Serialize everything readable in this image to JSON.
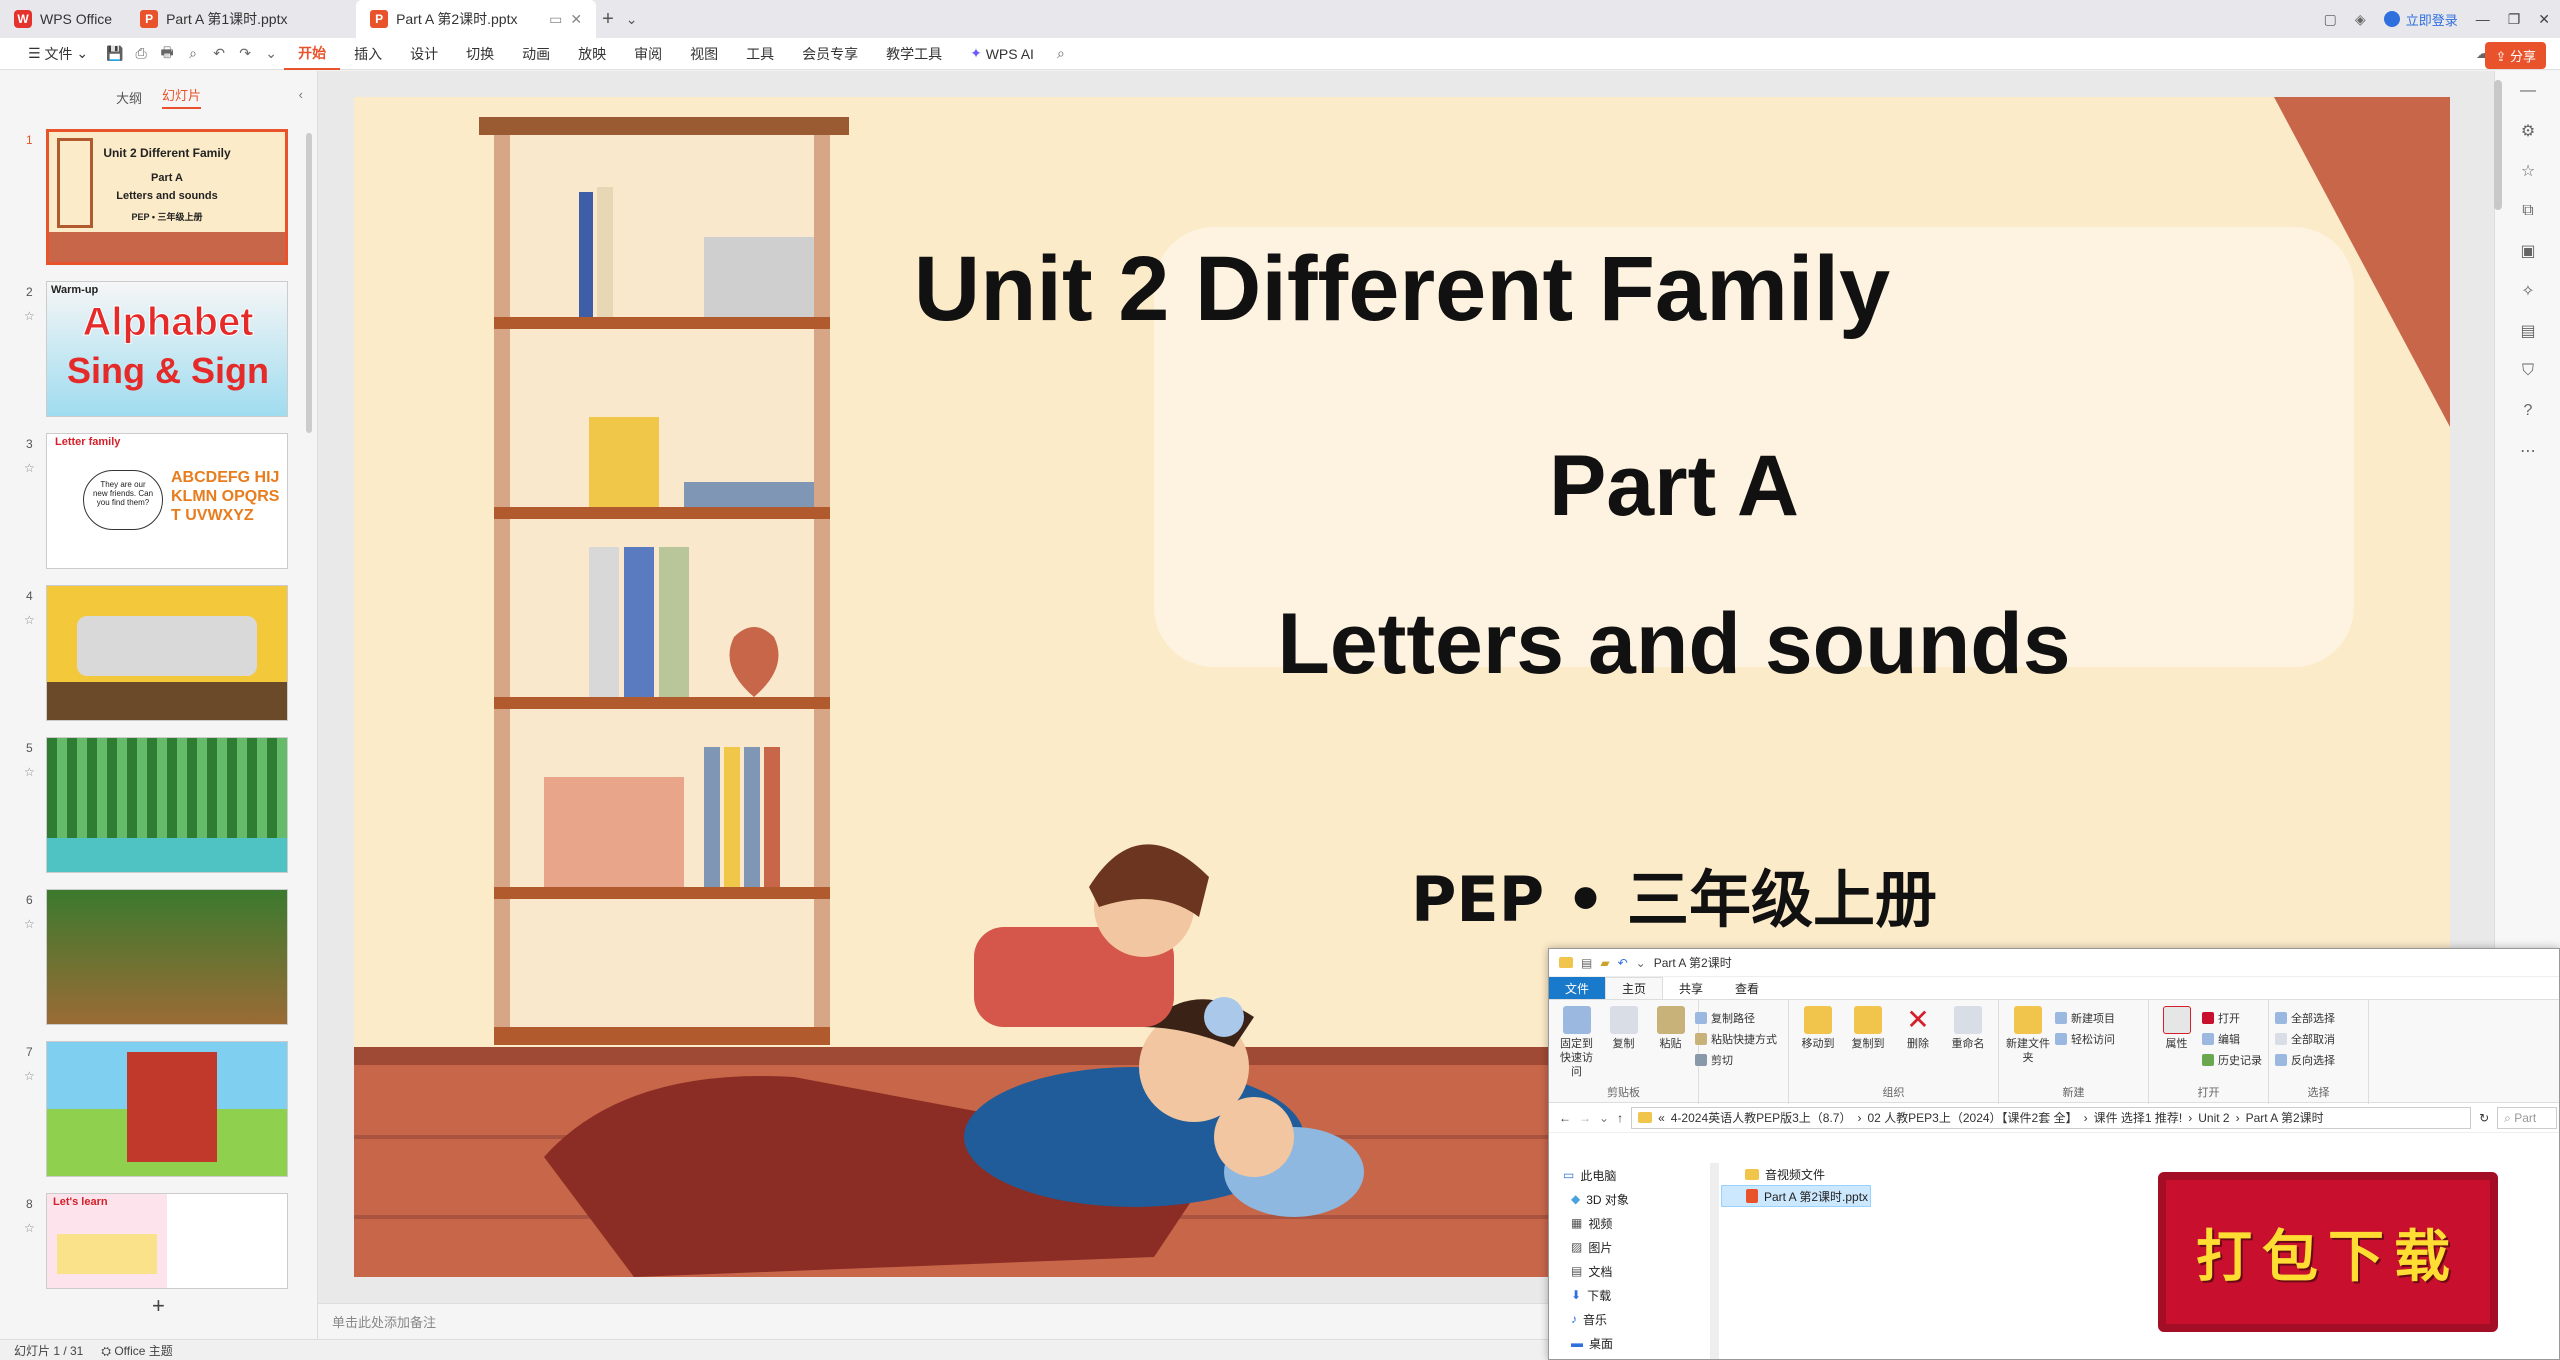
{
  "window": {
    "tabs": [
      {
        "label": "WPS Office"
      },
      {
        "label": "Part A 第1课时.pptx"
      },
      {
        "label": "Part A 第2课时.pptx"
      }
    ],
    "new_tab": "+",
    "login": "立即登录"
  },
  "menu": {
    "file": "文件",
    "items": [
      "开始",
      "插入",
      "设计",
      "切换",
      "动画",
      "放映",
      "审阅",
      "视图",
      "工具",
      "会员专享",
      "教学工具"
    ],
    "ai": "WPS AI",
    "share": "分享"
  },
  "panel": {
    "tab_outline": "大纲",
    "tab_slides": "幻灯片",
    "thumbs": [
      {
        "num": "1",
        "t1": "Unit 2 Different Family",
        "t2": "Part A",
        "t3": "Letters and sounds",
        "t4": "PEP • 三年级上册"
      },
      {
        "num": "2",
        "tag": "Warm-up",
        "t1": "Alphabet",
        "t2": "Sing & Sign"
      },
      {
        "num": "3",
        "tag": "Letter family",
        "bubble": "They are our new friends. Can you find them?",
        "letters": "ABCDEFG HIJKLMN OPQRST UVWXYZ"
      },
      {
        "num": "4"
      },
      {
        "num": "5"
      },
      {
        "num": "6"
      },
      {
        "num": "7"
      },
      {
        "num": "8",
        "tag": "Let's learn"
      }
    ]
  },
  "slide": {
    "title": "Unit 2 Different Family",
    "part": "Part A",
    "subtitle": "Letters and sounds",
    "edition": "PEP • 三年级上册"
  },
  "notes_placeholder": "单击此处添加备注",
  "status": {
    "slide_count": "幻灯片 1 / 31",
    "theme": "Office 主题"
  },
  "explorer": {
    "title": "Part A 第2课时",
    "tabs": [
      "文件",
      "主页",
      "共享",
      "查看"
    ],
    "groups": [
      {
        "name": "剪贴板",
        "big": [
          "固定到快速访问",
          "复制",
          "粘贴"
        ],
        "small": [
          "复制路径",
          "粘贴快捷方式",
          "剪切"
        ]
      },
      {
        "name": "组织",
        "big": [
          "移动到",
          "复制到",
          "删除",
          "重命名"
        ],
        "small": []
      },
      {
        "name": "新建",
        "big": [
          "新建文件夹"
        ],
        "small": [
          "新建项目",
          "轻松访问"
        ]
      },
      {
        "name": "打开",
        "big": [
          "属性"
        ],
        "small": [
          "打开",
          "编辑",
          "历史记录"
        ]
      },
      {
        "name": "选择",
        "big": [],
        "small": [
          "全部选择",
          "全部取消",
          "反向选择"
        ]
      }
    ],
    "crumbs": [
      "«",
      "4-2024英语人教PEP版3上（8.7）",
      "›",
      "02 人教PEP3上（2024）【课件2套 全】",
      "›",
      "课件 选择1  推荐!",
      "›",
      "Unit 2",
      "›",
      "Part A 第2课时"
    ],
    "search": "Part",
    "nav": [
      "此电脑",
      "3D 对象",
      "视频",
      "图片",
      "文档",
      "下载",
      "音乐",
      "桌面"
    ],
    "files": [
      "音视频文件",
      "Part A 第2课时.pptx"
    ]
  },
  "download_badge": "打包下载"
}
